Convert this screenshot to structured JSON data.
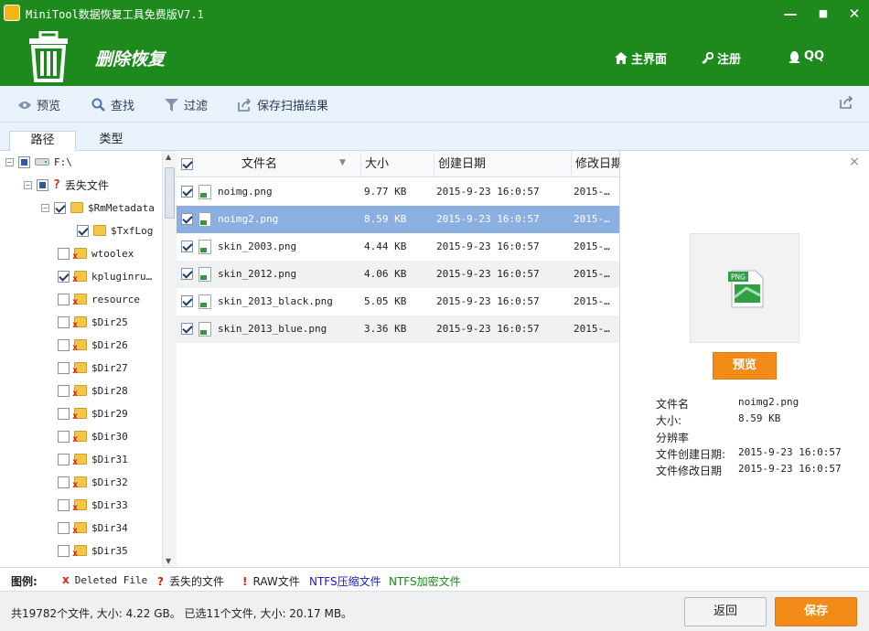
{
  "window": {
    "title": "MiniTool数据恢复工具免费版V7.1",
    "minimize": "—",
    "maximize": "■",
    "close": "✕"
  },
  "header": {
    "title": "删除恢复",
    "nav": {
      "home": "主界面",
      "register": "注册",
      "qq": "QQ"
    }
  },
  "toolbar": {
    "preview": "预览",
    "find": "查找",
    "filter": "过滤",
    "save_results": "保存扫描结果"
  },
  "tabs": {
    "path": "路径",
    "type": "类型"
  },
  "tree": {
    "root": "F:\\",
    "lost": "丢失文件",
    "rmmetadata": "$RmMetadata",
    "txflog": "$TxfLog",
    "items": [
      "wtoolex",
      "kpluginru…",
      "resource",
      "$Dir25",
      "$Dir26",
      "$Dir27",
      "$Dir28",
      "$Dir29",
      "$Dir30",
      "$Dir31",
      "$Dir32",
      "$Dir33",
      "$Dir34",
      "$Dir35"
    ]
  },
  "files": {
    "columns": {
      "name": "文件名",
      "size": "大小",
      "created": "创建日期",
      "modified": "修改日期"
    },
    "rows": [
      {
        "name": "noimg.png",
        "size": "9.77 KB",
        "created": "2015-9-23 16:0:57",
        "modified": "2015-…"
      },
      {
        "name": "noimg2.png",
        "size": "8.59 KB",
        "created": "2015-9-23 16:0:57",
        "modified": "2015-…"
      },
      {
        "name": "skin_2003.png",
        "size": "4.44 KB",
        "created": "2015-9-23 16:0:57",
        "modified": "2015-…"
      },
      {
        "name": "skin_2012.png",
        "size": "4.06 KB",
        "created": "2015-9-23 16:0:57",
        "modified": "2015-…"
      },
      {
        "name": "skin_2013_black.png",
        "size": "5.05 KB",
        "created": "2015-9-23 16:0:57",
        "modified": "2015-…"
      },
      {
        "name": "skin_2013_blue.png",
        "size": "3.36 KB",
        "created": "2015-9-23 16:0:57",
        "modified": "2015-…"
      }
    ]
  },
  "preview": {
    "close": "×",
    "thumb_label": "PNG",
    "button": "预览",
    "labels": {
      "filename": "文件名",
      "size": "大小:",
      "resolution": "分辨率",
      "created": "文件创建日期:",
      "modified": "文件修改日期"
    },
    "values": {
      "filename": "noimg2.png",
      "size": "8.59 KB",
      "created": "2015-9-23 16:0:57",
      "modified": "2015-9-23 16:0:57"
    }
  },
  "legend": {
    "title": "图例:",
    "deleted": "Deleted File",
    "lost": "丢失的文件",
    "raw": "RAW文件",
    "ntfs_compressed": "NTFS压缩文件",
    "ntfs_encrypted": "NTFS加密文件",
    "colors": {
      "ntfs_compressed": "#1a1ac8",
      "ntfs_encrypted": "#138a13"
    }
  },
  "status": {
    "summary": "共19782个文件, 大小: 4.22 GB。 已选11个文件, 大小: 20.17 MB。",
    "back": "返回",
    "save": "保存"
  },
  "colors": {
    "brand_green": "#1e8a1e",
    "accent_orange": "#f28b17",
    "selection": "#8aafe0"
  }
}
